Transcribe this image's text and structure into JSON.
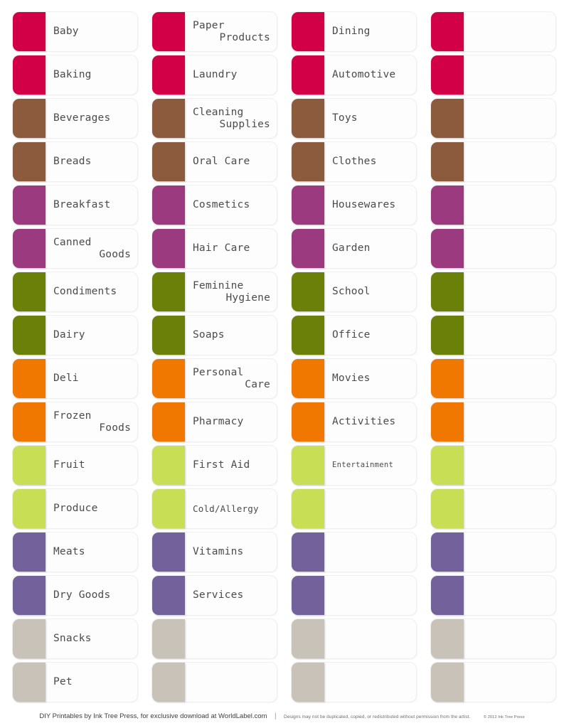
{
  "sheet": {
    "columns": 4,
    "rows": 16,
    "palette": {
      "crimson": "#D10047",
      "brown": "#8C5B3E",
      "magenta": "#9B3A7F",
      "olive": "#6B8008",
      "orange": "#F07800",
      "lime": "#C8DE55",
      "violet": "#72619B",
      "taupe": "#C9C2B8"
    },
    "label_background": "#FDFDFD",
    "text_color": "#4C4A4B"
  },
  "labels": [
    [
      {
        "color": "crimson",
        "lines": [
          "Baby"
        ]
      },
      {
        "color": "crimson",
        "lines": [
          "Paper",
          "Products"
        ]
      },
      {
        "color": "crimson",
        "lines": [
          "Dining"
        ]
      },
      {
        "color": "crimson",
        "lines": []
      }
    ],
    [
      {
        "color": "crimson",
        "lines": [
          "Baking"
        ]
      },
      {
        "color": "crimson",
        "lines": [
          "Laundry"
        ]
      },
      {
        "color": "crimson",
        "lines": [
          "Automotive"
        ]
      },
      {
        "color": "crimson",
        "lines": []
      }
    ],
    [
      {
        "color": "brown",
        "lines": [
          "Beverages"
        ]
      },
      {
        "color": "brown",
        "lines": [
          "Cleaning",
          "Supplies"
        ]
      },
      {
        "color": "brown",
        "lines": [
          "Toys"
        ]
      },
      {
        "color": "brown",
        "lines": []
      }
    ],
    [
      {
        "color": "brown",
        "lines": [
          "Breads"
        ]
      },
      {
        "color": "brown",
        "lines": [
          "Oral Care"
        ]
      },
      {
        "color": "brown",
        "lines": [
          "Clothes"
        ]
      },
      {
        "color": "brown",
        "lines": []
      }
    ],
    [
      {
        "color": "magenta",
        "lines": [
          "Breakfast"
        ]
      },
      {
        "color": "magenta",
        "lines": [
          "Cosmetics"
        ]
      },
      {
        "color": "magenta",
        "lines": [
          "Housewares"
        ]
      },
      {
        "color": "magenta",
        "lines": []
      }
    ],
    [
      {
        "color": "magenta",
        "lines": [
          "Canned",
          "Goods"
        ]
      },
      {
        "color": "magenta",
        "lines": [
          "Hair Care"
        ]
      },
      {
        "color": "magenta",
        "lines": [
          "Garden"
        ]
      },
      {
        "color": "magenta",
        "lines": []
      }
    ],
    [
      {
        "color": "olive",
        "lines": [
          "Condiments"
        ]
      },
      {
        "color": "olive",
        "lines": [
          "Feminine",
          "Hygiene"
        ]
      },
      {
        "color": "olive",
        "lines": [
          "School"
        ]
      },
      {
        "color": "olive",
        "lines": []
      }
    ],
    [
      {
        "color": "olive",
        "lines": [
          "Dairy"
        ]
      },
      {
        "color": "olive",
        "lines": [
          "Soaps"
        ]
      },
      {
        "color": "olive",
        "lines": [
          "Office"
        ]
      },
      {
        "color": "olive",
        "lines": []
      }
    ],
    [
      {
        "color": "orange",
        "lines": [
          "Deli"
        ]
      },
      {
        "color": "orange",
        "lines": [
          "Personal",
          "Care"
        ]
      },
      {
        "color": "orange",
        "lines": [
          "Movies"
        ]
      },
      {
        "color": "orange",
        "lines": []
      }
    ],
    [
      {
        "color": "orange",
        "lines": [
          "Frozen",
          "Foods"
        ]
      },
      {
        "color": "orange",
        "lines": [
          "Pharmacy"
        ]
      },
      {
        "color": "orange",
        "lines": [
          "Activities"
        ]
      },
      {
        "color": "orange",
        "lines": []
      }
    ],
    [
      {
        "color": "lime",
        "lines": [
          "Fruit"
        ]
      },
      {
        "color": "lime",
        "lines": [
          "First Aid"
        ]
      },
      {
        "color": "lime",
        "lines": [
          "Entertainment"
        ],
        "size": "small"
      },
      {
        "color": "lime",
        "lines": []
      }
    ],
    [
      {
        "color": "lime",
        "lines": [
          "Produce"
        ]
      },
      {
        "color": "lime",
        "lines": [
          "Cold/Allergy"
        ],
        "size": "mid"
      },
      {
        "color": "lime",
        "lines": []
      },
      {
        "color": "lime",
        "lines": []
      }
    ],
    [
      {
        "color": "violet",
        "lines": [
          "Meats"
        ]
      },
      {
        "color": "violet",
        "lines": [
          "Vitamins"
        ]
      },
      {
        "color": "violet",
        "lines": []
      },
      {
        "color": "violet",
        "lines": []
      }
    ],
    [
      {
        "color": "violet",
        "lines": [
          "Dry Goods"
        ]
      },
      {
        "color": "violet",
        "lines": [
          "Services"
        ]
      },
      {
        "color": "violet",
        "lines": []
      },
      {
        "color": "violet",
        "lines": []
      }
    ],
    [
      {
        "color": "taupe",
        "lines": [
          "Snacks"
        ]
      },
      {
        "color": "taupe",
        "lines": []
      },
      {
        "color": "taupe",
        "lines": []
      },
      {
        "color": "taupe",
        "lines": []
      }
    ],
    [
      {
        "color": "taupe",
        "lines": [
          "Pet"
        ]
      },
      {
        "color": "taupe",
        "lines": []
      },
      {
        "color": "taupe",
        "lines": []
      },
      {
        "color": "taupe",
        "lines": []
      }
    ]
  ],
  "footer": {
    "main": "DIY Printables by Ink Tree Press, for exclusive download at WorldLabel.com",
    "separator": "|",
    "terms": "Designs may not be duplicated, copied, or redistributed without permission from the artist.",
    "copyright": "© 2012 Ink Tree Press"
  }
}
